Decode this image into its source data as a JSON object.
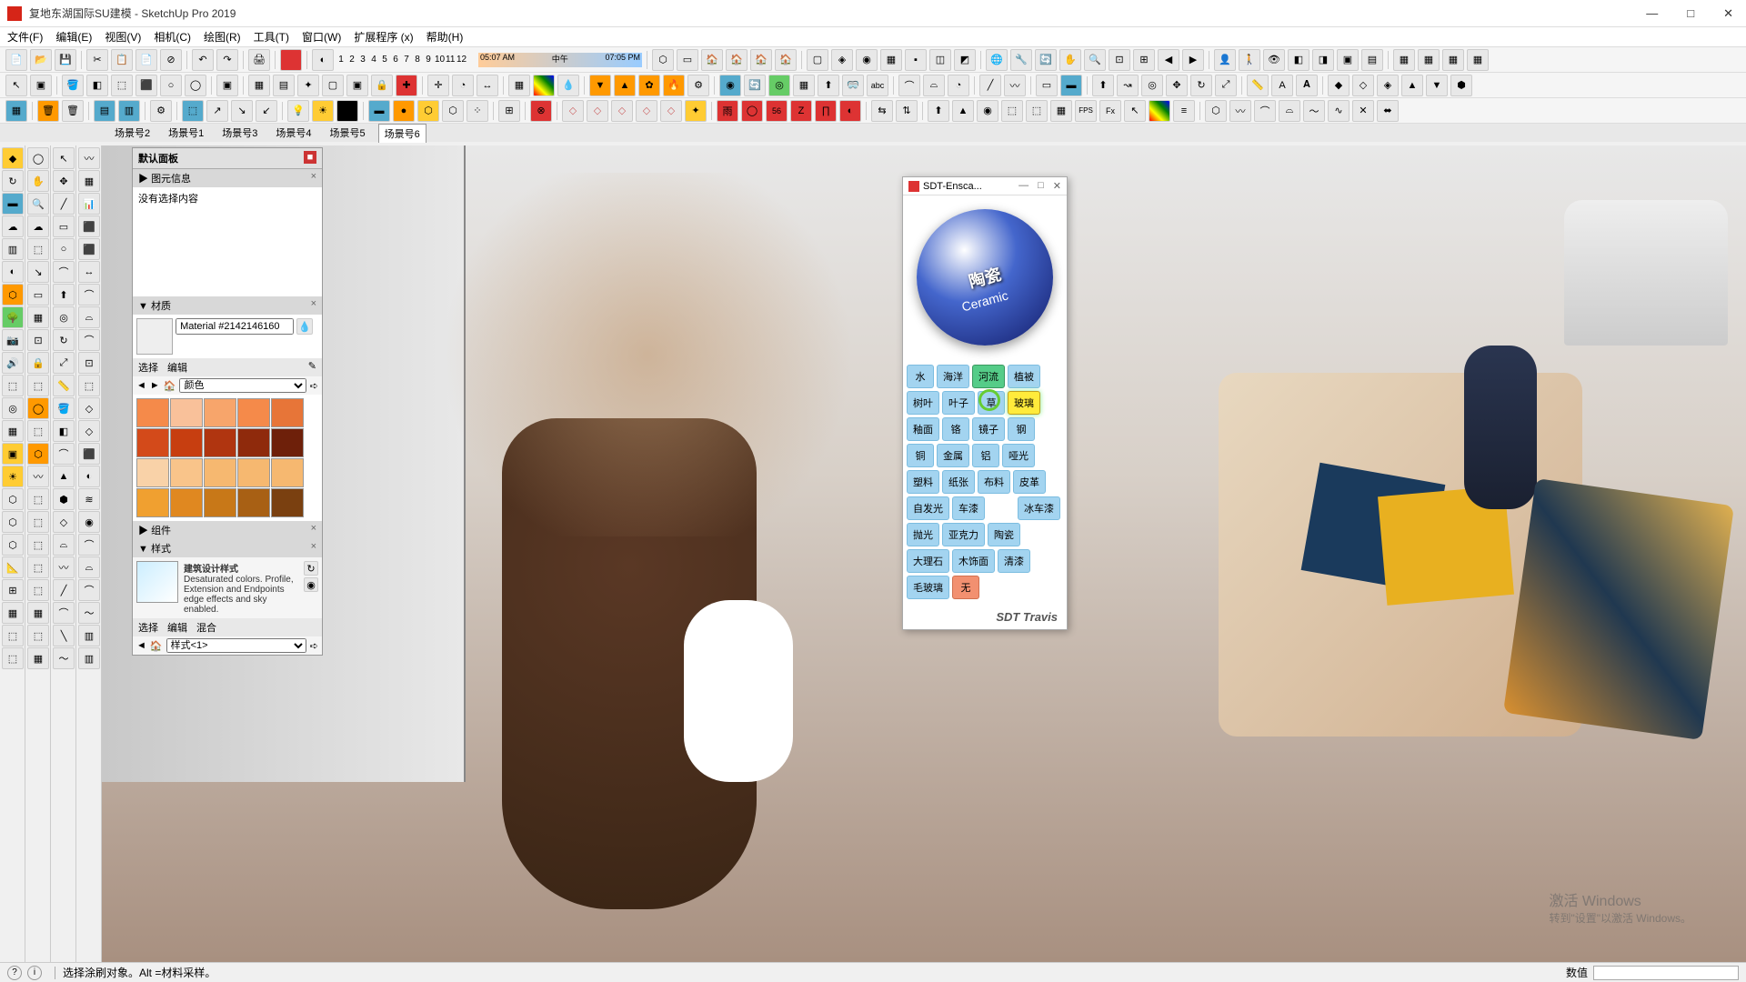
{
  "app": {
    "title": "复地东湖国际SU建模 - SketchUp Pro 2019"
  },
  "window_controls": {
    "min": "—",
    "max": "□",
    "close": "✕"
  },
  "menu": [
    "文件(F)",
    "编辑(E)",
    "视图(V)",
    "相机(C)",
    "绘图(R)",
    "工具(T)",
    "窗口(W)",
    "扩展程序 (x)",
    "帮助(H)"
  ],
  "time_ruler": {
    "start": "05:07 AM",
    "mid": "中午",
    "end": "07:05 PM"
  },
  "num_ruler": [
    "1",
    "2",
    "3",
    "4",
    "5",
    "6",
    "7",
    "8",
    "9",
    "10",
    "11",
    "12"
  ],
  "scene_tabs": {
    "items": [
      "场景号2",
      "场景号1",
      "场景号3",
      "场景号4",
      "场景号5",
      "场景号6"
    ],
    "active_index": 5
  },
  "default_panel": {
    "title": "默认面板",
    "sections": {
      "entity_info": {
        "title": "图元信息",
        "content": "没有选择内容"
      },
      "materials": {
        "title": "材质",
        "material_name": "Material #2142146160",
        "tabs": {
          "select": "选择",
          "edit": "编辑"
        },
        "dropdown": "颜色",
        "swatches": [
          "#f58a4a",
          "#f9c19a",
          "#f7a56b",
          "#f58a4a",
          "#e77538",
          "#d34a1a",
          "#c73e10",
          "#b03510",
          "#8f2a0c",
          "#6e200a",
          "#f9d2a8",
          "#f9c48a",
          "#f6b870",
          "#f6b870",
          "#f6b870",
          "#f0a030",
          "#e08820",
          "#c87818",
          "#a86014",
          "#7a4010"
        ]
      },
      "components": {
        "title": "组件"
      },
      "styles": {
        "title": "样式",
        "style_name": "建筑设计样式",
        "style_desc": "Desaturated colors. Profile, Extension and Endpoints edge effects and sky enabled.",
        "tabs": {
          "select": "选择",
          "edit": "编辑",
          "mix": "混合"
        },
        "dropdown": "样式<1>"
      }
    }
  },
  "enscape_panel": {
    "title": "SDT-Ensca...",
    "sphere_label": "陶瓷",
    "sphere_sub": "Ceramic",
    "buttons": [
      {
        "label": "水"
      },
      {
        "label": "海洋"
      },
      {
        "label": "河流",
        "sel": true
      },
      {
        "label": "植被"
      },
      {
        "label": "树叶"
      },
      {
        "label": "叶子"
      },
      {
        "label": "草"
      },
      {
        "label": "玻璃",
        "active": true
      },
      {
        "label": "釉面"
      },
      {
        "label": "铬"
      },
      {
        "label": "镜子"
      },
      {
        "label": "钢"
      },
      {
        "label": "铜"
      },
      {
        "label": "金属"
      },
      {
        "label": "铝"
      },
      {
        "label": "哑光"
      },
      {
        "label": "塑料"
      },
      {
        "label": "纸张"
      },
      {
        "label": "布料"
      },
      {
        "label": "皮革"
      },
      {
        "label": "自发光"
      },
      {
        "label": "车漆"
      },
      {
        "label": "",
        "blank": true
      },
      {
        "label": "冰车漆"
      },
      {
        "label": "抛光"
      },
      {
        "label": "亚克力"
      },
      {
        "label": "陶瓷"
      },
      {
        "label": "大理石"
      },
      {
        "label": "木饰面"
      },
      {
        "label": "清漆"
      },
      {
        "label": "毛玻璃"
      },
      {
        "label": "无",
        "none": true
      }
    ],
    "footer": "SDT  Travis"
  },
  "watermark": {
    "line1": "激活 Windows",
    "line2": "转到\"设置\"以激活 Windows。"
  },
  "statusbar": {
    "hint": "选择涂刷对象。Alt =材料采样。",
    "right": "数值"
  }
}
